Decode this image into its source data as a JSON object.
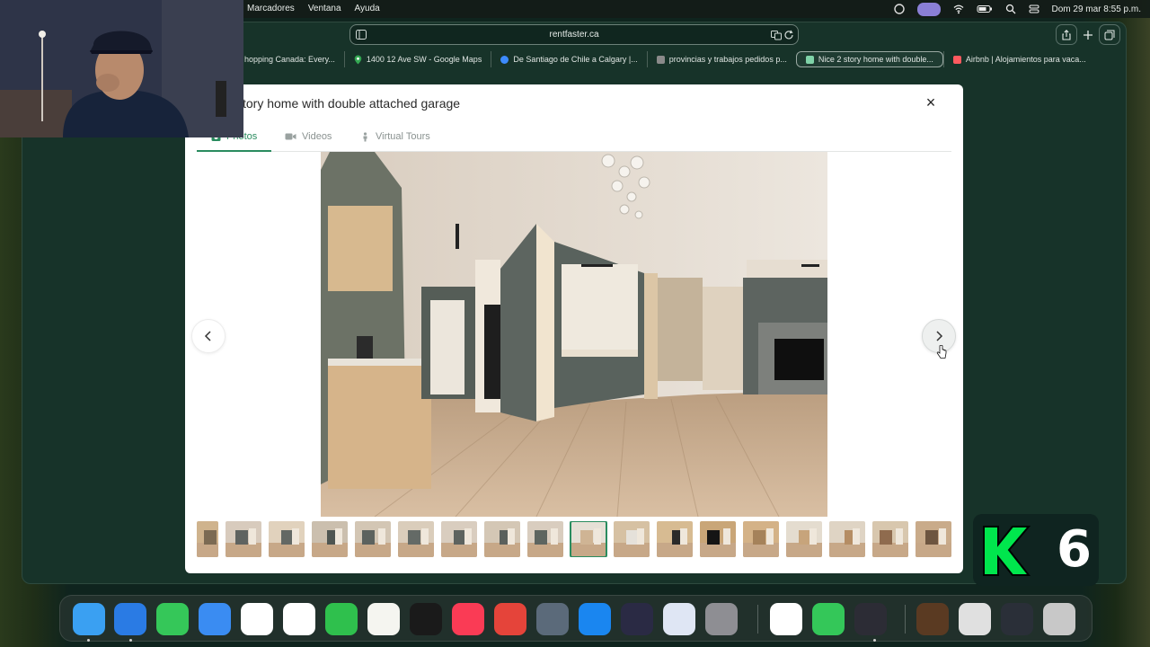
{
  "menubar": {
    "items": [
      "Marcadores",
      "Ventana",
      "Ayuda"
    ],
    "clock": "Dom 29 mar  8:55 p.m."
  },
  "browser": {
    "url": "rentfaster.ca",
    "tabs": [
      {
        "label": "hopping Canada: Every...",
        "icon": "shopping-favicon",
        "color": "#c9c9c9"
      },
      {
        "label": "1400 12 Ave SW - Google Maps",
        "icon": "maps-favicon",
        "color": "#4caf50"
      },
      {
        "label": "De Santiago de Chile a Calgary |...",
        "icon": "travel-favicon",
        "color": "#3d8bfd"
      },
      {
        "label": "provincias y trabajos pedidos p...",
        "icon": "google-favicon",
        "color": "#8a8a8a"
      },
      {
        "label": "Nice 2 story home with double...",
        "icon": "rentfaster-favicon",
        "color": "#7fd3a8",
        "active": true
      },
      {
        "label": "Airbnb | Alojamientos para vaca...",
        "icon": "airbnb-favicon",
        "color": "#ff5a5f"
      }
    ]
  },
  "modal": {
    "title": "tory home with double attached garage",
    "close": "×",
    "tabs": {
      "photos": "Photos",
      "videos": "Videos",
      "virtual_tours": "Virtual Tours"
    },
    "accent": "#2a8c5f",
    "thumb_count": 18,
    "selected_thumb": 9
  },
  "overlay": {
    "text": "6",
    "color": "#00e64d"
  },
  "dock": {
    "apps": [
      "Finder",
      "Safari",
      "Messages",
      "Mail",
      "Maps",
      "Photos",
      "FaceTime",
      "Notes",
      "TV",
      "Music",
      "Rocket Typist",
      "OmniFocus",
      "App Store",
      "DaVinci Resolve",
      "Simulator",
      "System Settings",
      "QuickTime",
      "Phone",
      "OBS",
      "Age of Empires",
      "Preview",
      "Screenshots",
      "Trash"
    ]
  }
}
